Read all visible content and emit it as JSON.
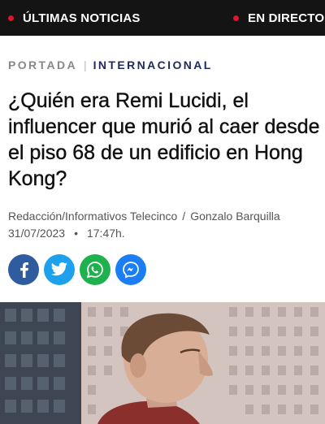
{
  "topbar": {
    "latest_label": "ÚLTIMAS NOTICIAS",
    "live_label": "EN DIRECTO"
  },
  "breadcrumb": {
    "home": "PORTADA",
    "category": "INTERNACIONAL"
  },
  "article": {
    "title": "¿Quién era Remi Lucidi, el influencer que murió al caer desde el piso 68 de un edificio en Hong Kong?",
    "source": "Redacción/Informativos Telecinco",
    "author": "Gonzalo Barquilla",
    "date": "31/07/2023",
    "time": "17:47h."
  },
  "share": {
    "icons": [
      "facebook-icon",
      "twitter-icon",
      "whatsapp-icon",
      "messenger-icon"
    ]
  },
  "colors": {
    "topbar_bg": "#141414",
    "live_dot": "#e0142c",
    "category": "#1e2a5a",
    "facebook": "#2f5c9e",
    "twitter": "#1ea1ec",
    "whatsapp": "#1fb14d",
    "messenger": "#1b7ef5"
  }
}
